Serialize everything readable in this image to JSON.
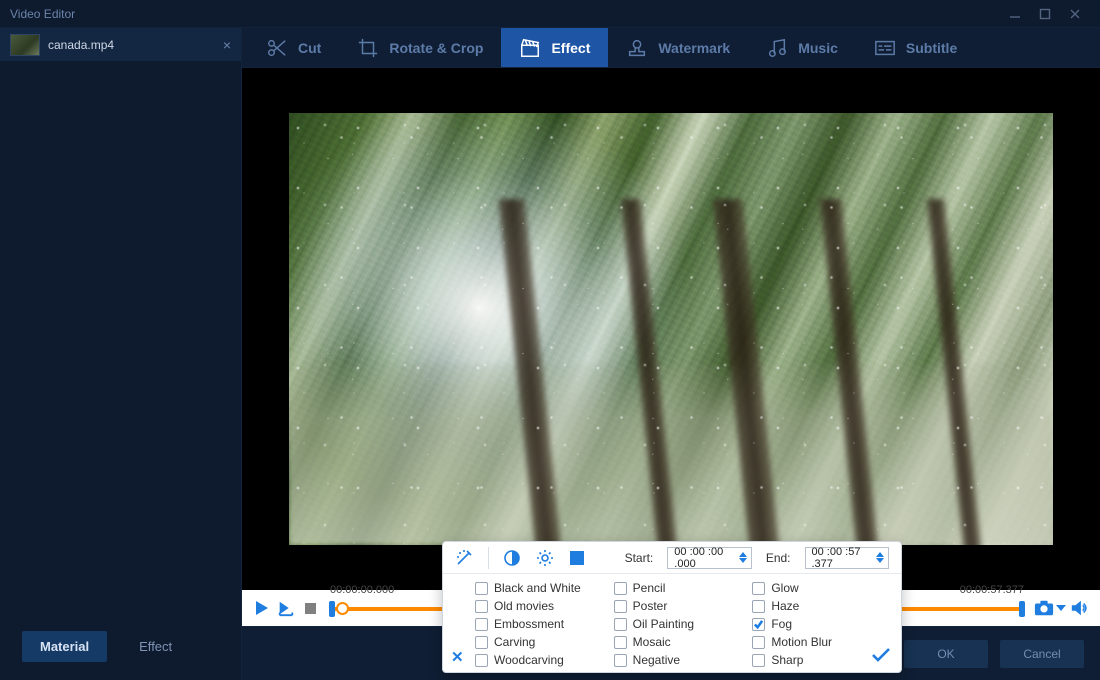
{
  "window": {
    "title": "Video Editor"
  },
  "sidebar": {
    "file": {
      "name": "canada.mp4"
    },
    "tabs": [
      {
        "label": "Material",
        "active": true
      },
      {
        "label": "Effect",
        "active": false
      }
    ]
  },
  "toolbar": {
    "items": [
      {
        "label": "Cut",
        "icon": "scissors",
        "active": false
      },
      {
        "label": "Rotate & Crop",
        "icon": "crop",
        "active": false
      },
      {
        "label": "Effect",
        "icon": "clapboard",
        "active": true
      },
      {
        "label": "Watermark",
        "icon": "stamp",
        "active": false
      },
      {
        "label": "Music",
        "icon": "note",
        "active": false
      },
      {
        "label": "Subtitle",
        "icon": "subtitle",
        "active": false
      }
    ]
  },
  "timeline": {
    "t_start": "00:00:00.000",
    "t_range": "00:00:00.000-00:00:57.377",
    "t_end": "00:00:57.377"
  },
  "effect_panel": {
    "start_label": "Start:",
    "start_value": "00 :00 :00 .000",
    "end_label": "End:",
    "end_value": "00 :00 :57 .377",
    "columns": [
      [
        {
          "label": "Black and White",
          "checked": false
        },
        {
          "label": "Old movies",
          "checked": false
        },
        {
          "label": "Embossment",
          "checked": false
        },
        {
          "label": "Carving",
          "checked": false
        },
        {
          "label": "Woodcarving",
          "checked": false
        }
      ],
      [
        {
          "label": "Pencil",
          "checked": false
        },
        {
          "label": "Poster",
          "checked": false
        },
        {
          "label": "Oil Painting",
          "checked": false
        },
        {
          "label": "Mosaic",
          "checked": false
        },
        {
          "label": "Negative",
          "checked": false
        }
      ],
      [
        {
          "label": "Glow",
          "checked": false
        },
        {
          "label": "Haze",
          "checked": false
        },
        {
          "label": "Fog",
          "checked": true
        },
        {
          "label": "Motion Blur",
          "checked": false
        },
        {
          "label": "Sharp",
          "checked": false
        }
      ]
    ]
  },
  "dialog": {
    "ok": "OK",
    "cancel": "Cancel"
  }
}
